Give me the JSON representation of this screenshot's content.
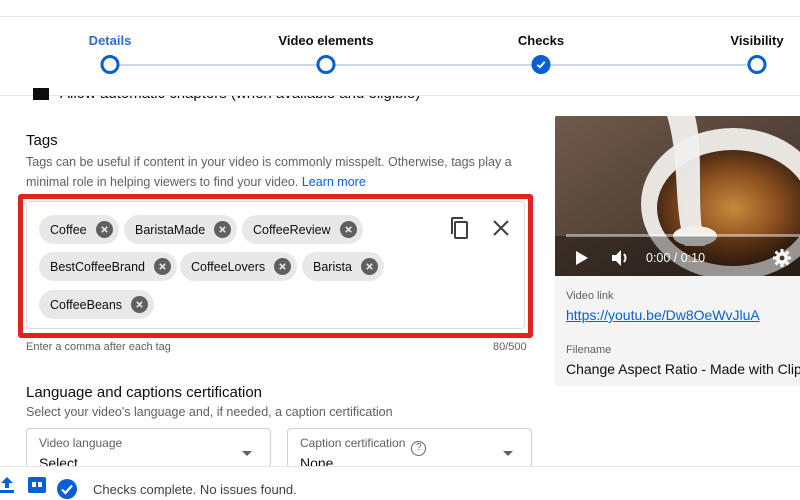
{
  "stepper": {
    "steps": [
      {
        "label": "Details",
        "state": "current"
      },
      {
        "label": "Video elements",
        "state": "pending"
      },
      {
        "label": "Checks",
        "state": "done"
      },
      {
        "label": "Visibility",
        "state": "pending"
      }
    ]
  },
  "chapters": {
    "label": "Allow automatic chapters (when available and eligible)",
    "checked": true
  },
  "tags": {
    "title": "Tags",
    "description": "Tags can be useful if content in your video is commonly misspelt. Otherwise, tags play a minimal role in helping viewers to find your video.",
    "learn_more": "Learn more",
    "chips": [
      "Coffee",
      "BaristaMade",
      "CoffeeReview",
      "BestCoffeeBrand",
      "CoffeeLovers",
      "Barista",
      "CoffeeBeans"
    ],
    "hint": "Enter a comma after each tag",
    "count": "80/500",
    "copy_icon": "copy-icon",
    "clear_icon": "close-icon",
    "highlight_color": "#e12222"
  },
  "language": {
    "title": "Language and captions certification",
    "description": "Select your video's language and, if needed, a caption certification",
    "video_language_label": "Video language",
    "video_language_value": "Select",
    "caption_label": "Caption certification",
    "caption_value": "None"
  },
  "preview": {
    "time": "0:00 / 0:10",
    "video_link_label": "Video link",
    "video_link": "https://youtu.be/Dw8OeWvJluA",
    "filename_label": "Filename",
    "filename": "Change Aspect Ratio - Made with Clip"
  },
  "footer": {
    "status": "Checks complete. No issues found."
  },
  "colors": {
    "accent": "#065fd4",
    "chip_bg": "#e8e8e8"
  }
}
